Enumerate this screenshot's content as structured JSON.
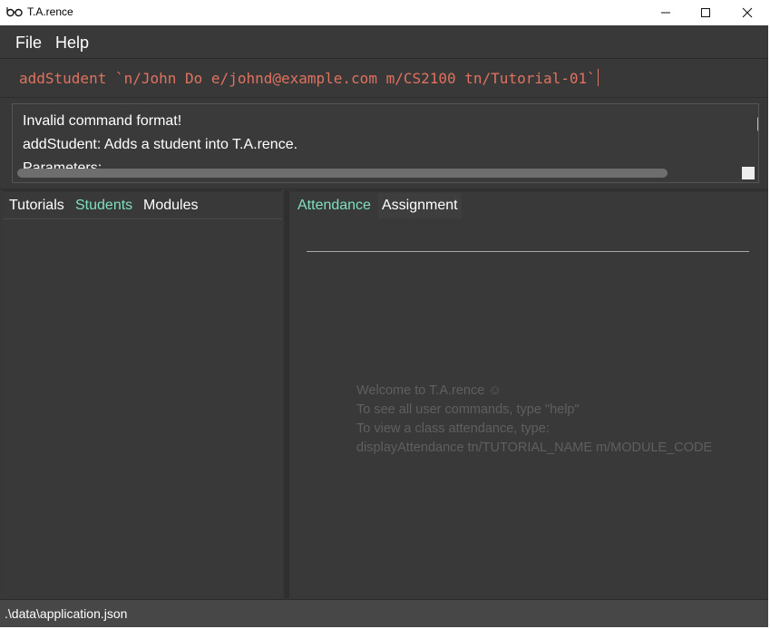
{
  "window": {
    "title": "T.A.rence",
    "controls": {
      "minimize": "—",
      "maximize": "☐",
      "close": "✕"
    }
  },
  "menu": {
    "file": "File",
    "help": "Help"
  },
  "command": {
    "value": "addStudent `n/John Do e/johnd@example.com m/CS2100 tn/Tutorial-01`",
    "color": "#e0725f"
  },
  "result": {
    "line1": "Invalid command format!",
    "line2": "addStudent: Adds a student into T.A.rence.",
    "line3": "Parameters:"
  },
  "left_tabs": {
    "tutorials": "Tutorials",
    "students": "Students",
    "modules": "Modules",
    "active": "Students"
  },
  "right_tabs": {
    "attendance": "Attendance",
    "assignment": "Assignment",
    "active": "Attendance"
  },
  "welcome": {
    "line1": "Welcome to T.A.rence ☺",
    "line2": "To see all user commands, type \"help\"",
    "line3": "To view a class attendance, type:",
    "line4": "displayAttendance tn/TUTORIAL_NAME m/MODULE_CODE"
  },
  "status": {
    "path": ".\\data\\application.json"
  },
  "colors": {
    "accent": "#7ee0bf",
    "background": "#383838",
    "error_text": "#e0725f"
  }
}
